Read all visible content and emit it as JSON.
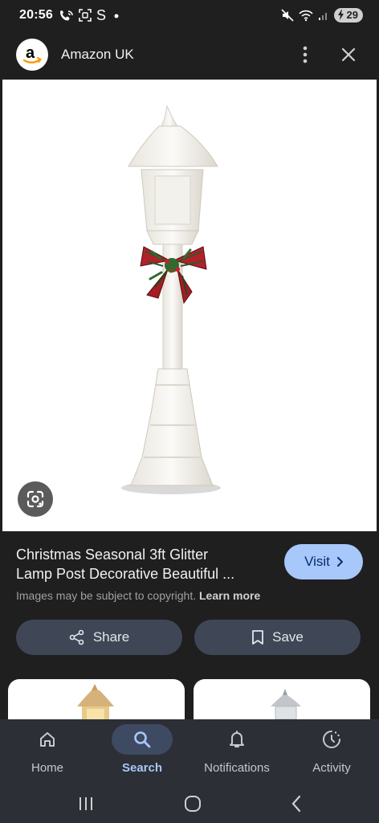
{
  "status_bar": {
    "time": "20:56",
    "battery": "29"
  },
  "header": {
    "logo_letter": "a",
    "title": "Amazon UK"
  },
  "product": {
    "title_line1": "Christmas Seasonal 3ft Glitter",
    "title_line2": "Lamp Post Decorative Beautiful ...",
    "visit_label": "Visit",
    "copyright_text": "Images may be subject to copyright.",
    "learn_more": "Learn more"
  },
  "actions": {
    "share_label": "Share",
    "save_label": "Save"
  },
  "bottom_nav": {
    "items": [
      {
        "label": "Home",
        "icon": "home-icon"
      },
      {
        "label": "Search",
        "icon": "search-icon"
      },
      {
        "label": "Notifications",
        "icon": "bell-icon"
      },
      {
        "label": "Activity",
        "icon": "activity-icon"
      }
    ],
    "active": "Search"
  },
  "colors": {
    "background": "#1f1f1f",
    "accent": "#a8c7fa",
    "action_button": "#3f4756",
    "nav_background": "#2c2f35"
  }
}
